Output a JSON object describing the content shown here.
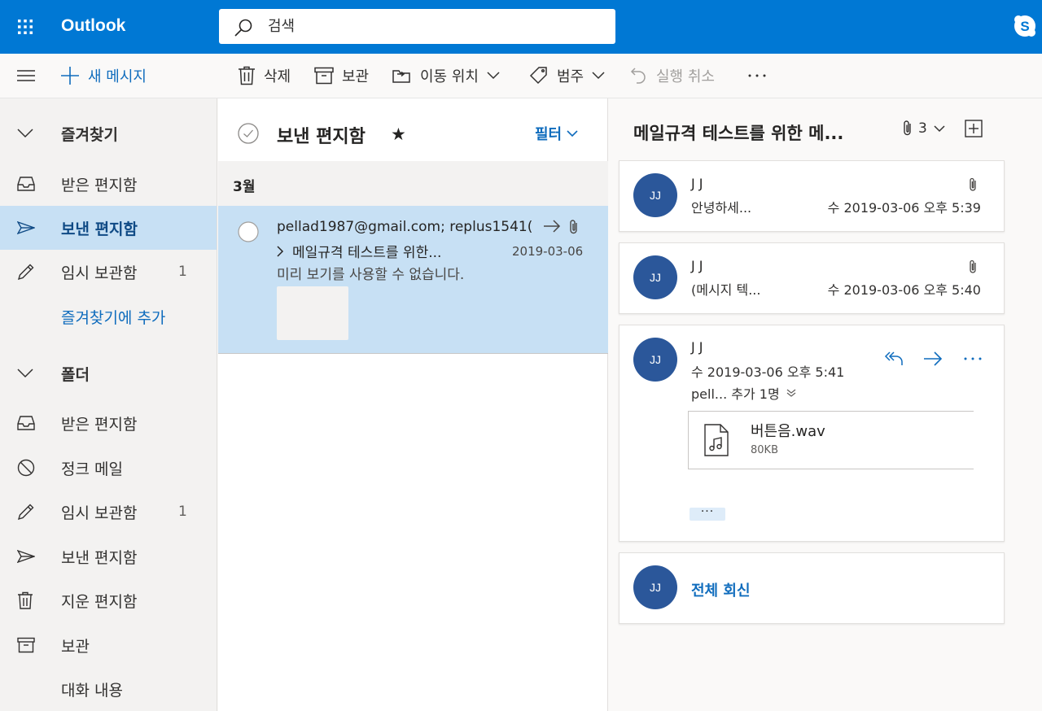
{
  "app": {
    "name": "Outlook"
  },
  "colors": {
    "brand": "#0078d4",
    "selected": "#c7e0f4",
    "accent": "#0f6cbd",
    "avatar": "#2b579a"
  },
  "search": {
    "placeholder": "검색"
  },
  "toolbar": {
    "new_message": "새 메시지",
    "delete": "삭제",
    "archive": "보관",
    "move_to": "이동 위치",
    "categorize": "범주",
    "undo": "실행 취소"
  },
  "sidebar": {
    "favorites_header": "즐겨찾기",
    "favorites": [
      {
        "label": "받은 편지함",
        "icon": "inbox-icon"
      },
      {
        "label": "보낸 편지함",
        "icon": "sent-icon",
        "selected": true
      },
      {
        "label": "임시 보관함",
        "icon": "drafts-icon",
        "count": "1"
      }
    ],
    "add_favorite": "즐겨찾기에 추가",
    "folders_header": "폴더",
    "folders": [
      {
        "label": "받은 편지함",
        "icon": "inbox-icon"
      },
      {
        "label": "정크 메일",
        "icon": "junk-icon"
      },
      {
        "label": "임시 보관함",
        "icon": "drafts-icon",
        "count": "1"
      },
      {
        "label": "보낸 편지함",
        "icon": "sent-icon"
      },
      {
        "label": "지운 편지함",
        "icon": "trash-icon"
      },
      {
        "label": "보관",
        "icon": "archive-icon"
      },
      {
        "label": "대화 내용"
      }
    ]
  },
  "message_list": {
    "title": "보낸 편지함",
    "filter": "필터",
    "group": "3월",
    "items": [
      {
        "to": "pellad1987@gmail.com; replus1541(",
        "subject": "메일규격 테스트를 위한...",
        "date": "2019-03-06",
        "preview": "미리 보기를 사용할 수 없습니다."
      }
    ]
  },
  "reading": {
    "subject": "메일규격 테스트를 위한 메...",
    "attachment_count": "3",
    "messages": [
      {
        "avatar": "JJ",
        "sender": "J J",
        "snippet": "안녕하세...",
        "date": "수 2019-03-06 오후 5:39"
      },
      {
        "avatar": "JJ",
        "sender": "J J",
        "snippet": "(메시지 텍...",
        "date": "수 2019-03-06 오후 5:40"
      },
      {
        "avatar": "JJ",
        "sender": "J J",
        "date": "수 2019-03-06 오후 5:41",
        "recipients": "pell... 추가 1명",
        "attachment": {
          "name": "버튼음.wav",
          "size": "80KB"
        },
        "show_more": "···"
      }
    ],
    "reply_all": {
      "avatar": "JJ",
      "label": "전체 회신"
    }
  }
}
